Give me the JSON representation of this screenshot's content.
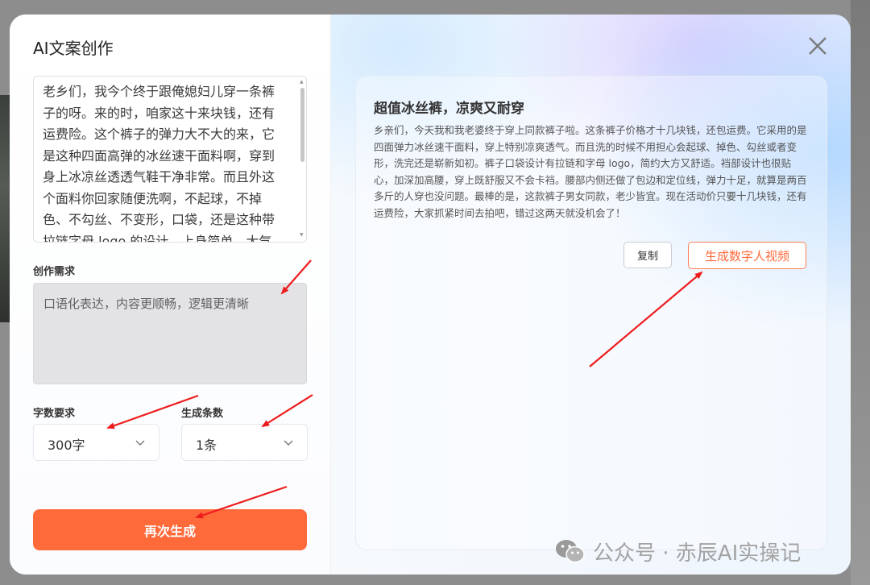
{
  "dialog": {
    "title": "AI文案创作",
    "source_text": "老乡们，我今个终于跟俺媳妇儿穿一条裤子的呀。来的时，咱家这十来块钱，还有运费险。这个裤子的弹力大不大的来，它是这种四面高弹的冰丝速干面料啊，穿到身上冰凉丝透透气鞋干净非常。而且外这个面料你回家随便洗啊，不起球，不掉色、不勾丝、不变形，口袋，还是这种带拉链字母 logo 的设计，上身简单，大气又",
    "requirement_label": "创作需求",
    "requirement_value": "口语化表达，内容更顺畅，逻辑更清晰",
    "word_count_label": "字数要求",
    "word_count_value": "300字",
    "count_label": "生成条数",
    "count_value": "1条",
    "regenerate_label": "再次生成"
  },
  "result": {
    "title": "超值冰丝裤，凉爽又耐穿",
    "body": "乡亲们，今天我和我老婆终于穿上同款裤子啦。这条裤子价格才十几块钱，还包运费。它采用的是四面弹力冰丝速干面料，穿上特别凉爽透气。而且洗的时候不用担心会起球、掉色、勾丝或者变形，洗完还是崭新如初。裤子口袋设计有拉链和字母 logo，简约大方又舒适。裆部设计也很贴心，加深加高腰，穿上既舒服又不会卡裆。腰部内侧还做了包边和定位线，弹力十足，就算是两百多斤的人穿也没问题。最棒的是，这款裤子男女同款，老少皆宜。现在活动价只要十几块钱，还有运费险，大家抓紧时间去拍吧，错过这两天就没机会了！",
    "copy_label": "复制",
    "digital_human_label": "生成数字人视频"
  },
  "watermark": {
    "text": "公众号 · 赤辰AI实操记"
  },
  "colors": {
    "accent": "#ff6a3b",
    "annotation_arrow": "#ee1c1c"
  }
}
